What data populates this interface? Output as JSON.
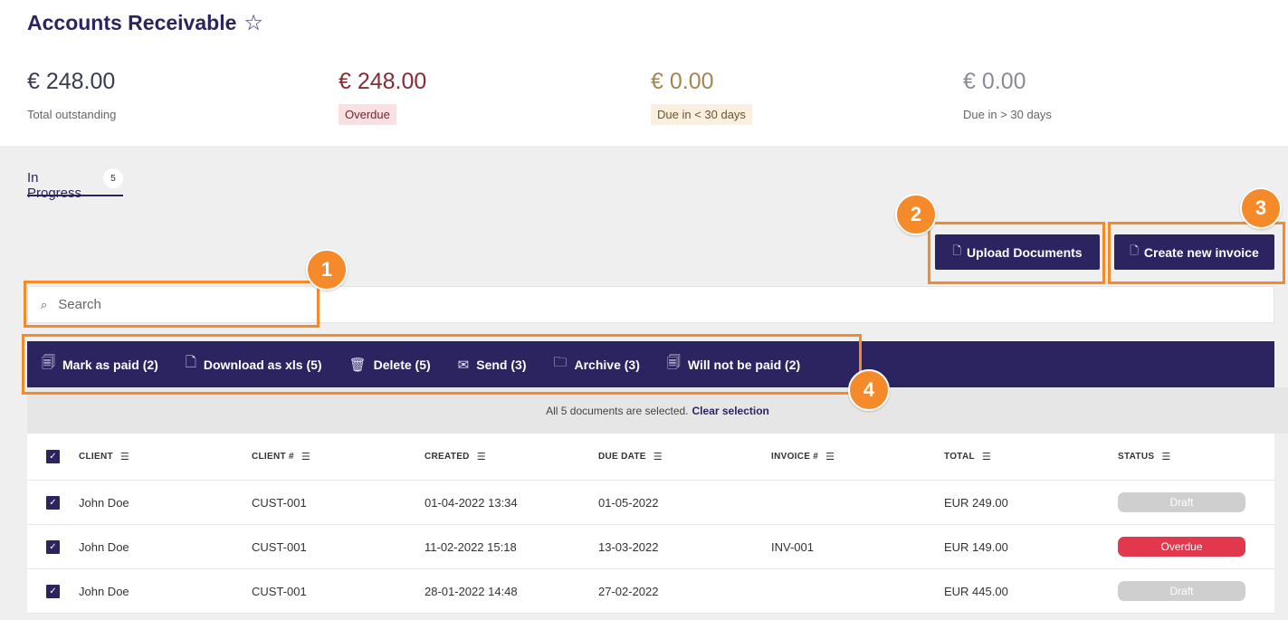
{
  "header": {
    "title": "Accounts Receivable",
    "star_icon": "star-icon"
  },
  "stats": [
    {
      "amount": "€ 248.00",
      "label": "Total outstanding"
    },
    {
      "amount": "€ 248.00",
      "label": "Overdue"
    },
    {
      "amount": "€ 0.00",
      "label": "Due in < 30 days"
    },
    {
      "amount": "€ 0.00",
      "label": "Due in > 30 days"
    }
  ],
  "tabs": [
    {
      "label": "In Progress",
      "count": "5"
    }
  ],
  "buttons": {
    "upload": "Upload Documents",
    "create": "Create new invoice"
  },
  "search": {
    "placeholder": "Search"
  },
  "actions": [
    {
      "label": "Mark as paid (2)",
      "icon": "paid-icon"
    },
    {
      "label": "Download as xls (5)",
      "icon": "download-icon"
    },
    {
      "label": "Delete (5)",
      "icon": "trash-icon"
    },
    {
      "label": "Send (3)",
      "icon": "mail-icon"
    },
    {
      "label": "Archive (3)",
      "icon": "folder-icon"
    },
    {
      "label": "Will not be paid (2)",
      "icon": "not-paid-icon"
    }
  ],
  "selection": {
    "text": "All 5 documents are selected.",
    "clear": "Clear selection"
  },
  "table": {
    "columns": [
      "CLIENT",
      "CLIENT #",
      "CREATED",
      "DUE DATE",
      "INVOICE #",
      "TOTAL",
      "STATUS"
    ],
    "rows": [
      {
        "client": "John Doe",
        "client_no": "CUST-001",
        "created": "01-04-2022 13:34",
        "due": "01-05-2022",
        "invoice": "",
        "total": "EUR 249.00",
        "status": "Draft"
      },
      {
        "client": "John Doe",
        "client_no": "CUST-001",
        "created": "11-02-2022 15:18",
        "due": "13-03-2022",
        "invoice": "INV-001",
        "total": "EUR 149.00",
        "status": "Overdue"
      },
      {
        "client": "John Doe",
        "client_no": "CUST-001",
        "created": "28-01-2022 14:48",
        "due": "27-02-2022",
        "invoice": "",
        "total": "EUR 445.00",
        "status": "Draft"
      }
    ]
  },
  "annotations": [
    "1",
    "2",
    "3",
    "4"
  ],
  "colors": {
    "brand": "#2b2461",
    "annotation": "#f58a2b",
    "overdue": "#e2384e",
    "draft": "#cfcfcf"
  }
}
